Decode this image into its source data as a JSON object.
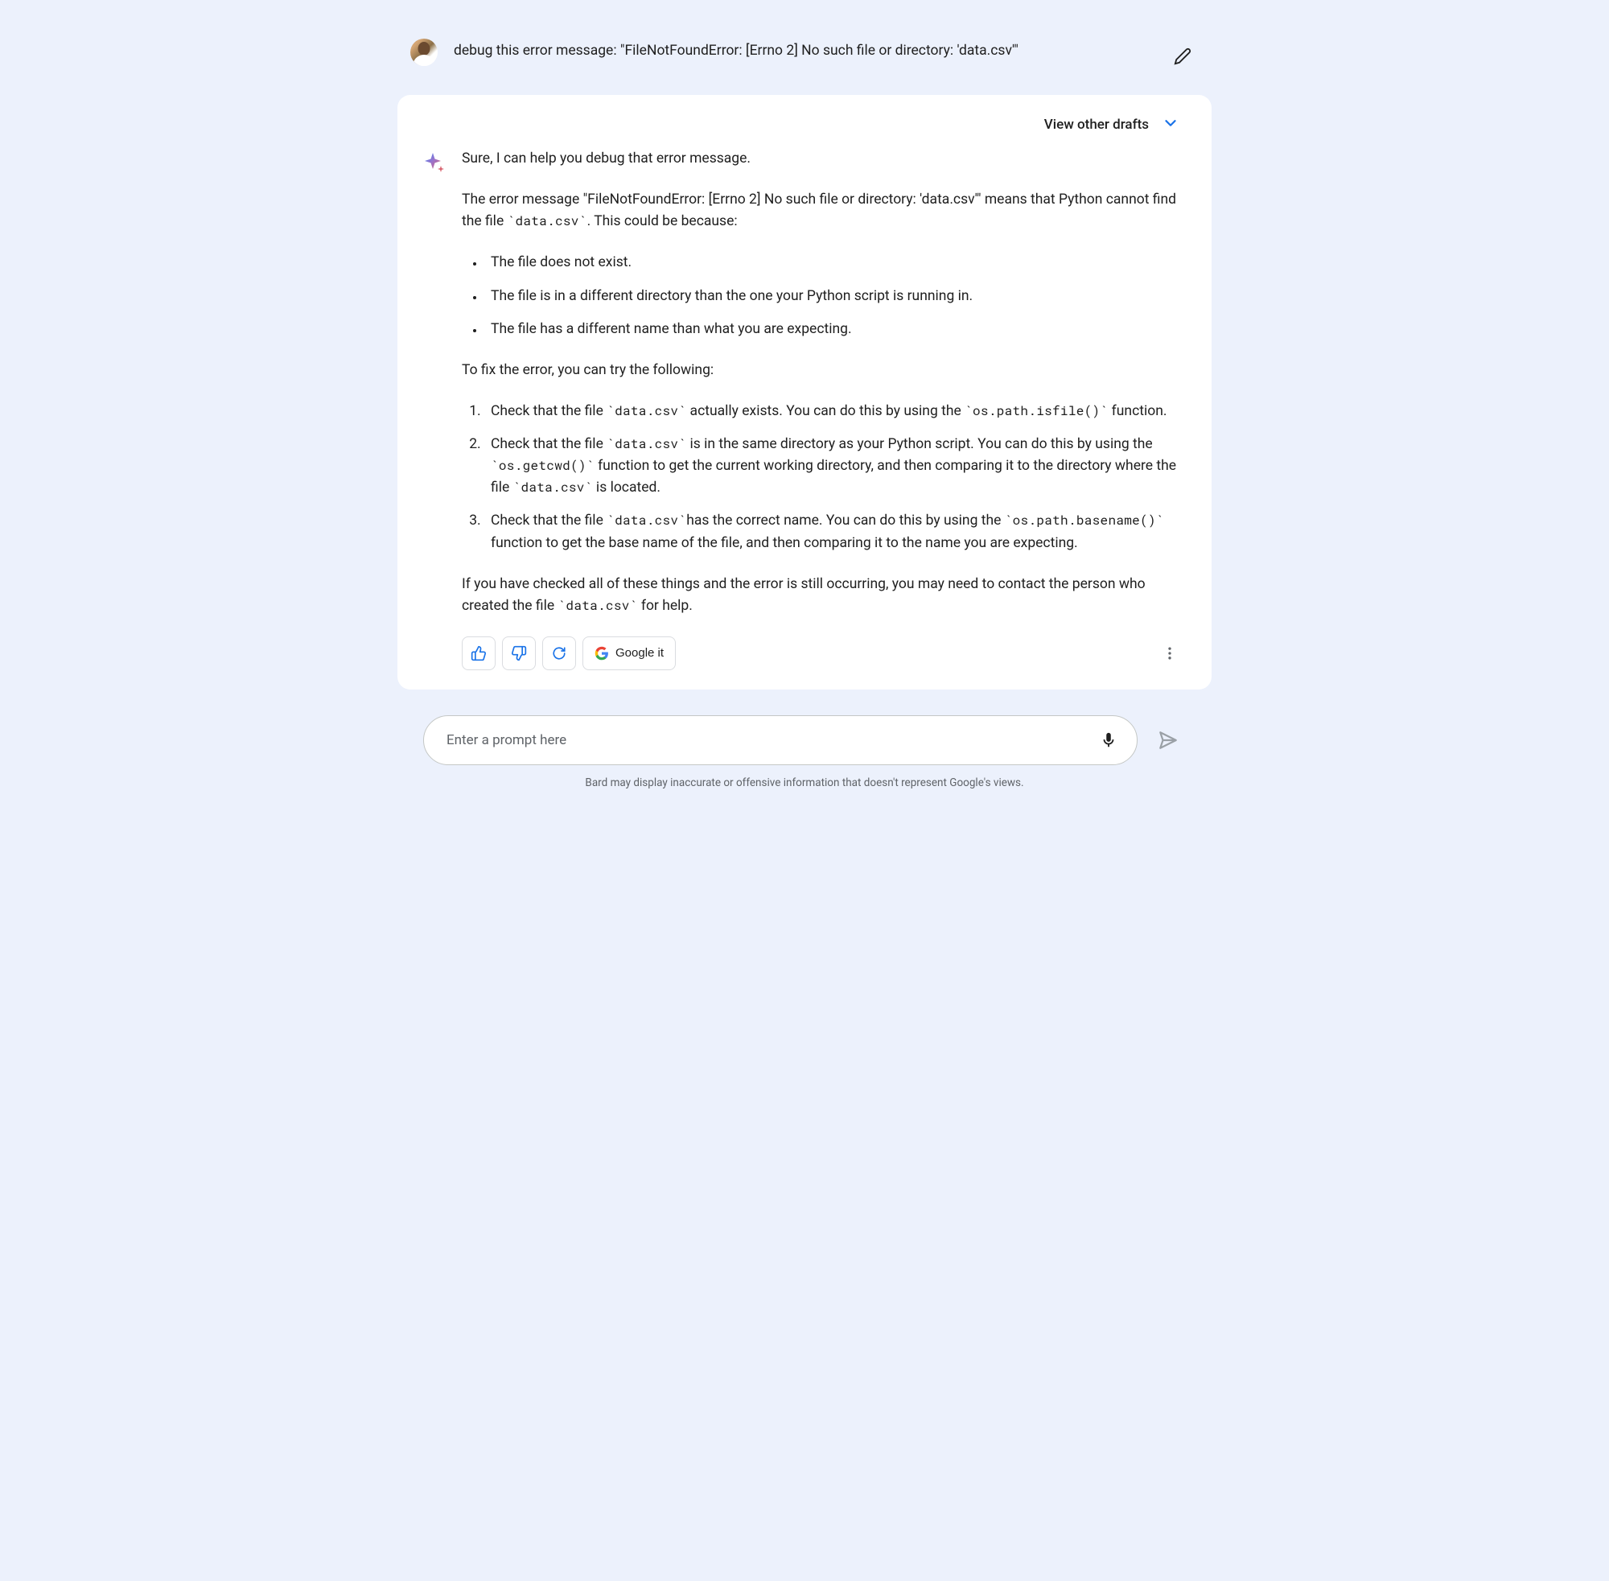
{
  "user": {
    "prompt": "debug this error message: \"FileNotFoundError: [Errno 2] No such file or directory: 'data.csv'\""
  },
  "drafts": {
    "label": "View other drafts"
  },
  "response": {
    "intro": "Sure, I can help you debug that error message.",
    "explain_pre": "The error message \"FileNotFoundError: [Errno 2] No such file or directory: 'data.csv'\" means that Python cannot find the file ",
    "explain_code": "`data.csv`",
    "explain_post": ". This could be because:",
    "causes": {
      "c1": "The file does not exist.",
      "c2": "The file is in a different directory than the one your Python script is running in.",
      "c3": "The file has a different name than what you are expecting."
    },
    "fix_intro": "To fix the error, you can try the following:",
    "fixes": {
      "f1_a": "Check that the file ",
      "f1_code1": "`data.csv`",
      "f1_b": " actually exists. You can do this by using the ",
      "f1_code2": "`os.path.isfile()`",
      "f1_c": " function.",
      "f2_a": "Check that the file ",
      "f2_code1": "`data.csv`",
      "f2_b": " is in the same directory as your Python script. You can do this by using the ",
      "f2_code2": "`os.getcwd()`",
      "f2_c": " function to get the current working directory, and then comparing it to the directory where the file ",
      "f2_code3": "`data.csv`",
      "f2_d": " is located.",
      "f3_a": "Check that the file ",
      "f3_code1": "`data.csv`",
      "f3_b": "has the correct name. You can do this by using the ",
      "f3_code2": "`os.path.basename()`",
      "f3_c": " function to get the base name of the file, and then comparing it to the name you are expecting."
    },
    "outro_a": "If you have checked all of these things and the error is still occurring, you may need to contact the person who created the file ",
    "outro_code": "`data.csv`",
    "outro_b": " for help."
  },
  "actions": {
    "google_it": "Google it"
  },
  "input": {
    "placeholder": "Enter a prompt here"
  },
  "footer": {
    "disclaimer": "Bard may display inaccurate or offensive information that doesn't represent Google's views."
  }
}
